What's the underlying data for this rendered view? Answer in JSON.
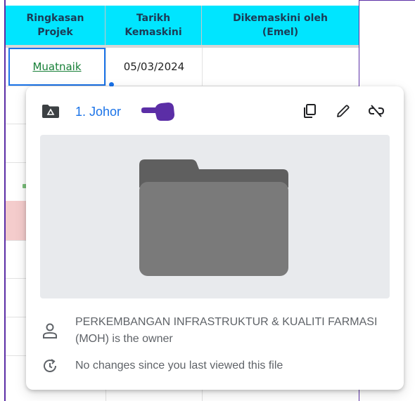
{
  "table": {
    "headers": [
      {
        "line1": "Ringkasan",
        "line2": "Projek"
      },
      {
        "line1": "Tarikh",
        "line2": "Kemaskini"
      },
      {
        "line1": "Dikemaskini oleh",
        "line2": "(Emel)"
      }
    ],
    "row1": {
      "link_label": "Muatnaik",
      "date": "05/03/2024",
      "email": ""
    },
    "header_color": "#00e5ff",
    "link_color": "#188038",
    "highlight_color": "#f4cccc"
  },
  "popup": {
    "file_name": "1. Johor",
    "link_color": "#1a73e8",
    "icons": {
      "file_type": "shared-drive-folder-icon",
      "pointer": "pointing-hand-icon",
      "copy": "copy-icon",
      "edit": "pencil-icon",
      "unlink": "unlink-icon",
      "preview": "folder-icon",
      "owner": "person-icon",
      "activity": "history-icon"
    },
    "owner_text": "PERKEMBANGAN INFRASTRUKTUR & KUALITI FARMASI (MOH) is the owner",
    "changes_text": "No changes since you last viewed this file"
  }
}
